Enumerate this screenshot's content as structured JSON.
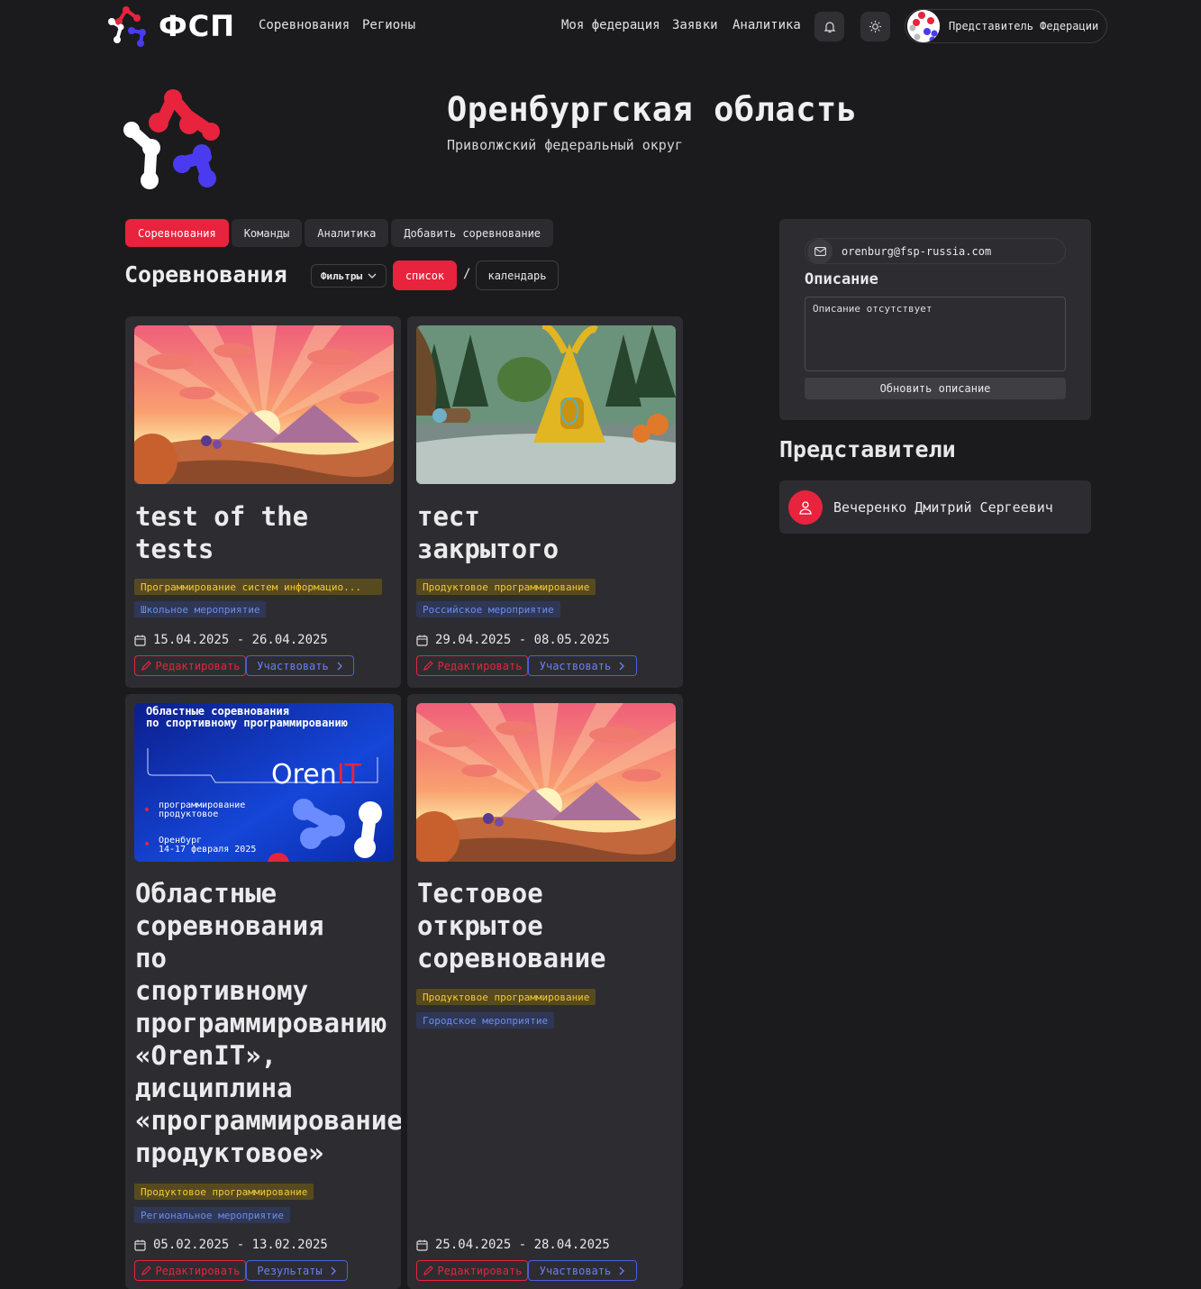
{
  "header": {
    "logo_text": "ФСП",
    "nav_left": [
      "Соревнования",
      "Регионы"
    ],
    "nav_right": [
      "Моя федерация",
      "Заявки",
      "Аналитика"
    ],
    "user_label": "Представитель Федерации"
  },
  "region": {
    "title": "Оренбургская область",
    "subtitle": "Приволжский федеральный округ"
  },
  "tabs": [
    "Соревнования",
    "Команды",
    "Аналитика",
    "Добавить соревнование"
  ],
  "section": {
    "title": "Соревнования",
    "filters": "Фильтры",
    "list": "список",
    "slash": "/",
    "calendar": "календарь"
  },
  "cards": [
    {
      "title": "test of the\ntests",
      "tag1": "Программирование систем информацио...",
      "tag2": "Школьное мероприятие",
      "dates": "15.04.2025 - 26.04.2025",
      "edit": "Редактировать",
      "action": "Участвовать"
    },
    {
      "title": "тест\nзакрытого",
      "tag1": "Продуктовое программирование",
      "tag2": "Российское мероприятие",
      "dates": "29.04.2025 - 08.05.2025",
      "edit": "Редактировать",
      "action": "Участвовать"
    },
    {
      "title": "Областные\nсоревнования\nпо\nспортивному\nпрограммированию\n«OrenIT»,\nдисциплина\n«программирование\nпродуктовое»",
      "tag1": "Продуктовое программирование",
      "tag2": "Региональное мероприятие",
      "dates": "05.02.2025 - 13.02.2025",
      "edit": "Редактировать",
      "action": "Результаты",
      "poster": {
        "line1": "Областные соревнования",
        "line2": "по спортивному программированию",
        "brand_a": "Oren",
        "brand_b": "IT",
        "d1": "программирование",
        "d2": "продуктовое",
        "city": "Оренбург",
        "when": "14-17 февраля 2025"
      }
    },
    {
      "title": "Тестовое\nоткрытое\nсоревнование",
      "tag1": "Продуктовое программирование",
      "tag2": "Городское мероприятие",
      "dates": "25.04.2025 - 28.04.2025",
      "edit": "Редактировать",
      "action": "Участвовать"
    }
  ],
  "sidebar": {
    "email": "orenburg@fsp-russia.com",
    "desc_title": "Описание",
    "desc_text": "Описание отсутствует",
    "update_btn": "Обновить описание",
    "reps_title": "Представители",
    "rep_name": "Вечеренко Дмитрий Сергеевич"
  },
  "colors": {
    "accent": "#e8233d",
    "blue": "#4b5fe0",
    "bg": "#1b1b1d",
    "card": "#2d2d31"
  }
}
